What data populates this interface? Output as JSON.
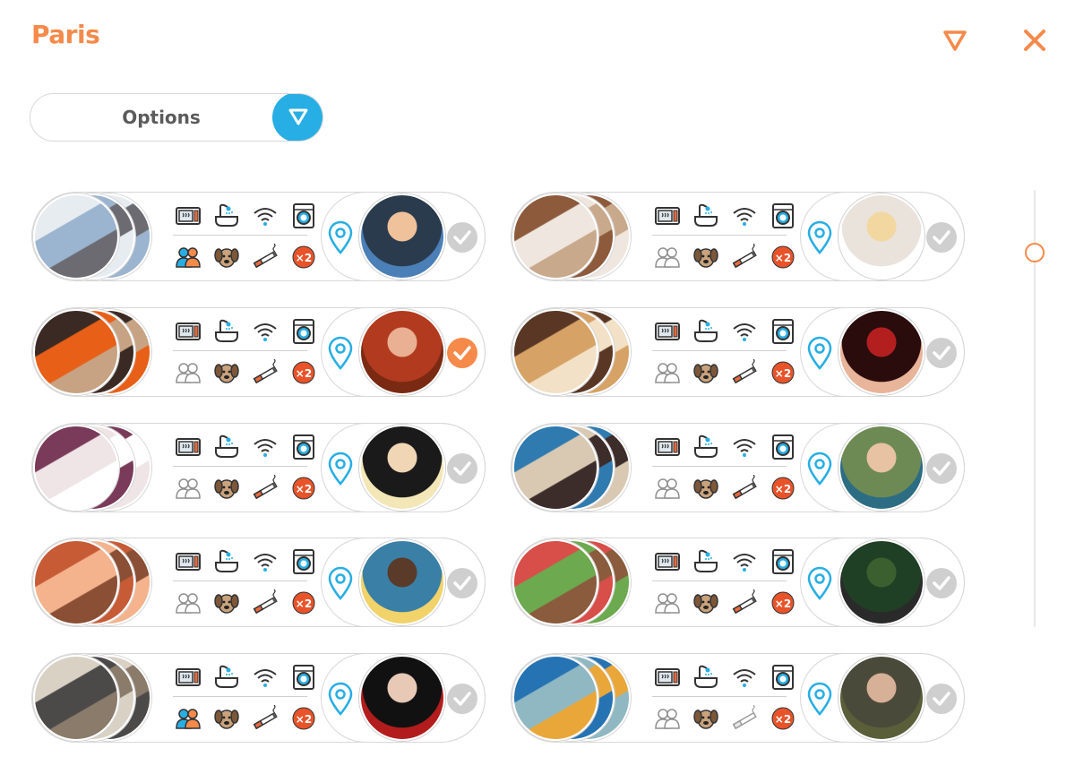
{
  "header": {
    "title": "Paris",
    "filter_icon": "filter-triangle-icon",
    "close_icon": "close-x-icon",
    "accent": "#f58a4a"
  },
  "options": {
    "label": "Options",
    "dropdown_icon": "filter-triangle-icon",
    "color": "#27aee4"
  },
  "amenity_icons": [
    "microwave-icon",
    "bathtub-icon",
    "wifi-icon",
    "washing-machine-icon",
    "people-icon",
    "dog-icon",
    "cigarette-icon",
    "x2-badge-icon"
  ],
  "listings": [
    {
      "room": [
        "#9bb4cf",
        "#e7ecf0",
        "#6d6b72"
      ],
      "host": [
        "#2a3b4e",
        "#f0c29b",
        "#4b7fb8"
      ],
      "people": true,
      "smoke": true,
      "selected": false
    },
    {
      "room": [
        "#efe7df",
        "#8d5a3c",
        "#c9a98b"
      ],
      "host": [
        "#e9e3dc",
        "#f2d7a0",
        "#ffffff"
      ],
      "people": false,
      "smoke": true,
      "selected": false
    },
    {
      "room": [
        "#e85f18",
        "#3b2a23",
        "#c7a384"
      ],
      "host": [
        "#b23a1e",
        "#e9b093",
        "#7a2a12"
      ],
      "people": false,
      "smoke": true,
      "selected": true
    },
    {
      "room": [
        "#d6a266",
        "#5a3725",
        "#f2e1c6"
      ],
      "host": [
        "#2a0c0c",
        "#b31f1f",
        "#e8b49a"
      ],
      "people": false,
      "smoke": true,
      "selected": false
    },
    {
      "room": [
        "#efe5e6",
        "#7a3a59",
        "#ffffff"
      ],
      "host": [
        "#1a1a1a",
        "#f1d6b5",
        "#f4e7b7"
      ],
      "people": false,
      "smoke": true,
      "selected": false
    },
    {
      "room": [
        "#d9c9b2",
        "#2f7bb0",
        "#3d2d2a"
      ],
      "host": [
        "#6e8a54",
        "#e7c2a3",
        "#2d6d83"
      ],
      "people": false,
      "smoke": true,
      "selected": false
    },
    {
      "room": [
        "#f4b38c",
        "#c65b36",
        "#8a4f34"
      ],
      "host": [
        "#3a7fa6",
        "#5a3a28",
        "#f1d36a"
      ],
      "people": false,
      "smoke": true,
      "selected": false
    },
    {
      "room": [
        "#6da94e",
        "#d84e49",
        "#8a5b3c"
      ],
      "host": [
        "#204025",
        "#3b5f2e",
        "#2a2a2a"
      ],
      "people": false,
      "smoke": true,
      "selected": false
    },
    {
      "room": [
        "#4c4a49",
        "#d8d1c4",
        "#8a7b6a"
      ],
      "host": [
        "#111111",
        "#e7c9b6",
        "#b31c1c"
      ],
      "people": true,
      "smoke": true,
      "selected": false
    },
    {
      "room": [
        "#8fb8c2",
        "#2673b3",
        "#e9a73a"
      ],
      "host": [
        "#4a4a3a",
        "#d7b098",
        "#5a5f3a"
      ],
      "people": false,
      "smoke": false,
      "selected": false
    }
  ],
  "scrollbar": {
    "position": 0.12
  }
}
